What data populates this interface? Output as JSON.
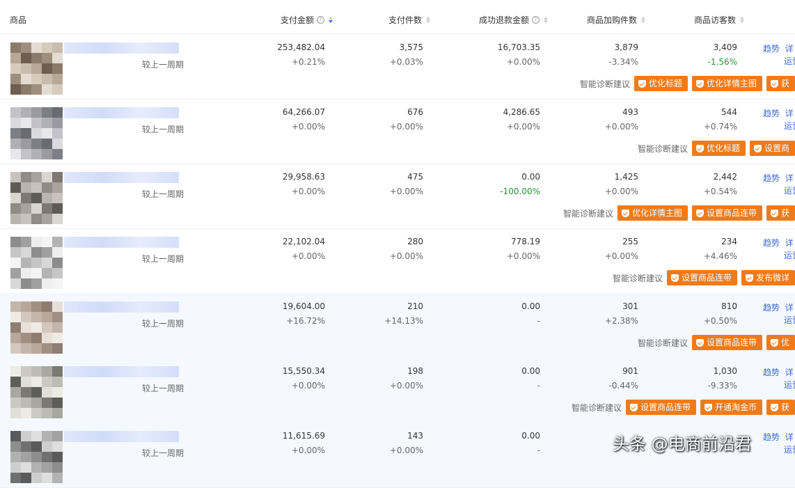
{
  "header": {
    "product": "商品",
    "pay_amount": "支付金额",
    "pay_count": "支付件数",
    "refund": "成功退款金额",
    "cart": "商品加购件数",
    "visitors": "商品访客数"
  },
  "compare_label": "较上一周期",
  "suggest_label": "智能诊断建议",
  "links": {
    "trend": "趋势",
    "detail": "详",
    "ops": "运营"
  },
  "rows": [
    {
      "pay": "253,482.04",
      "pay_c": "+0.21%",
      "qty": "3,575",
      "qty_c": "+0.03%",
      "refund": "16,703.35",
      "refund_c": "+0.00%",
      "cart": "3,879",
      "cart_c": "-3.34%",
      "visit": "3,409",
      "visit_c": "-1.56%",
      "suggestions": [
        "优化标题",
        "优化详情主图",
        "获"
      ]
    },
    {
      "pay": "64,266.07",
      "pay_c": "+0.00%",
      "qty": "676",
      "qty_c": "+0.00%",
      "refund": "4,286.65",
      "refund_c": "+0.00%",
      "cart": "493",
      "cart_c": "+0.00%",
      "visit": "544",
      "visit_c": "+0.74%",
      "suggestions": [
        "优化标题",
        "设置商"
      ]
    },
    {
      "pay": "29,958.63",
      "pay_c": "+0.00%",
      "qty": "475",
      "qty_c": "+0.00%",
      "refund": "0.00",
      "refund_c": "-100.00%",
      "cart": "1,425",
      "cart_c": "+0.00%",
      "visit": "2,442",
      "visit_c": "+0.54%",
      "suggestions": [
        "优化详情主图",
        "设置商品连带",
        "获"
      ]
    },
    {
      "pay": "22,102.04",
      "pay_c": "+0.00%",
      "qty": "280",
      "qty_c": "+0.00%",
      "refund": "778.19",
      "refund_c": "+0.00%",
      "cart": "255",
      "cart_c": "+0.00%",
      "visit": "234",
      "visit_c": "+4.46%",
      "suggestions": [
        "设置商品连带",
        "发布微详"
      ]
    },
    {
      "pay": "19,604.00",
      "pay_c": "+16.72%",
      "qty": "210",
      "qty_c": "+14.13%",
      "refund": "0.00",
      "refund_c": "-",
      "cart": "301",
      "cart_c": "+2.38%",
      "visit": "810",
      "visit_c": "+0.50%",
      "suggestions": [
        "设置商品连带",
        "优"
      ]
    },
    {
      "pay": "15,550.34",
      "pay_c": "+0.00%",
      "qty": "198",
      "qty_c": "+0.00%",
      "refund": "0.00",
      "refund_c": "-",
      "cart": "901",
      "cart_c": "-0.44%",
      "visit": "1,030",
      "visit_c": "-9.33%",
      "suggestions": [
        "设置商品连带",
        "开通淘金币",
        "获"
      ]
    },
    {
      "pay": "11,615.69",
      "pay_c": "+0.00%",
      "qty": "143",
      "qty_c": "+0.00%",
      "refund": "0.00",
      "refund_c": "-",
      "cart": "",
      "cart_c": "",
      "visit": "",
      "visit_c": "",
      "suggestions": []
    }
  ],
  "watermark": "头条 @电商前沿君"
}
